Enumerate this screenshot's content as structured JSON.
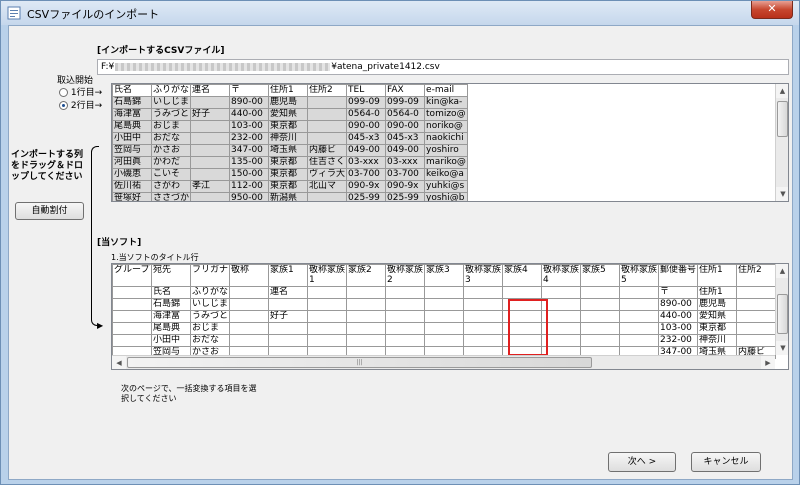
{
  "window": {
    "title": "CSVファイルのインポート",
    "close_label": "✕"
  },
  "import_section": {
    "title": "[インポートするCSVファイル]",
    "file_path_prefix": "F:¥",
    "file_path_suffix": "¥atena_private1412.csv"
  },
  "start_row": {
    "label": "取込開始",
    "options": [
      {
        "label": "1行目→",
        "selected": false
      },
      {
        "label": "2行目→",
        "selected": true
      }
    ]
  },
  "drag_hint": "インポートする列をドラッグ＆ドロップしてください",
  "auto_assign_label": "自動割付",
  "csv_columns": [
    "氏名",
    "ふりがな",
    "連名",
    "〒",
    "住所1",
    "住所2",
    "TEL",
    "FAX",
    "e-mail"
  ],
  "csv_rows": [
    [
      "石島錦",
      "いしじま",
      "",
      "890-00",
      "鹿児島",
      "",
      "099-09",
      "099-09",
      "kin@ka-"
    ],
    [
      "海津富",
      "うみづと",
      "好子",
      "440-00",
      "愛知県",
      "",
      "0564-0",
      "0564-0",
      "tomizo@"
    ],
    [
      "尾島典",
      "おじま",
      "",
      "103-00",
      "東京都",
      "",
      "090-00",
      "090-00",
      "noriko@"
    ],
    [
      "小田中",
      "おだな",
      "",
      "232-00",
      "神奈川",
      "",
      "045-x3",
      "045-x3",
      "naokichi"
    ],
    [
      "笠岡与",
      "かさお",
      "",
      "347-00",
      "埼玉県",
      "内藤ビ",
      "049-00",
      "049-00",
      "yoshiro"
    ],
    [
      "河田眞",
      "かわだ",
      "",
      "135-00",
      "東京都",
      "住吉さく",
      "03-xxx",
      "03-xxx",
      "mariko@"
    ],
    [
      "小磯恵",
      "こいそ",
      "",
      "150-00",
      "東京都",
      "ヴィラ大",
      "03-700",
      "03-700",
      "keiko@a"
    ],
    [
      "佐川祐",
      "さがわ",
      "孝江",
      "112-00",
      "東京都",
      "北山マ",
      "090-9x",
      "090-9x",
      "yuhki@s"
    ],
    [
      "笹塚好",
      "ささづか",
      "",
      "950-00",
      "新潟県",
      "",
      "025-99",
      "025-99",
      "yoshi@b"
    ]
  ],
  "soft_section": {
    "title": "[当ソフト]",
    "row1_label": "1.当ソフトのタイトル行",
    "columns": [
      "グループ",
      "宛先",
      "フリガナ",
      "敬称",
      "家族1",
      "敬称家族1",
      "家族2",
      "敬称家族2",
      "家族3",
      "敬称家族3",
      "家族4",
      "敬称家族4",
      "家族5",
      "敬称家族5",
      "郵便番号",
      "住所1",
      "住所2"
    ],
    "mapped": [
      "",
      "氏名",
      "ふりがな",
      "",
      "連名",
      "",
      "",
      "",
      "",
      "",
      "",
      "",
      "",
      "",
      "〒",
      "住所1",
      ""
    ],
    "rows": [
      [
        "",
        "石島錦",
        "いしじま",
        "",
        "",
        "",
        "",
        "",
        "",
        "",
        "",
        "",
        "",
        "",
        "890-00",
        "鹿児島",
        ""
      ],
      [
        "",
        "海津富",
        "うみづと",
        "",
        "好子",
        "",
        "",
        "",
        "",
        "",
        "",
        "",
        "",
        "",
        "440-00",
        "愛知県",
        ""
      ],
      [
        "",
        "尾島典",
        "おじま",
        "",
        "",
        "",
        "",
        "",
        "",
        "",
        "",
        "",
        "",
        "",
        "103-00",
        "東京都",
        ""
      ],
      [
        "",
        "小田中",
        "おだな",
        "",
        "",
        "",
        "",
        "",
        "",
        "",
        "",
        "",
        "",
        "",
        "232-00",
        "神奈川",
        ""
      ],
      [
        "",
        "笠岡与",
        "かさお",
        "",
        "",
        "",
        "",
        "",
        "",
        "",
        "",
        "",
        "",
        "",
        "347-00",
        "埼玉県",
        "内藤ビ"
      ]
    ]
  },
  "hscroll_grip": "|||",
  "bottom_hint": "次のページで、一括変換する項目を選択してください",
  "buttons": {
    "next": "次へ >",
    "cancel": "キャンセル"
  },
  "colors": {
    "highlight_border": "#e02020",
    "title_bar": "#c5d7ec"
  }
}
